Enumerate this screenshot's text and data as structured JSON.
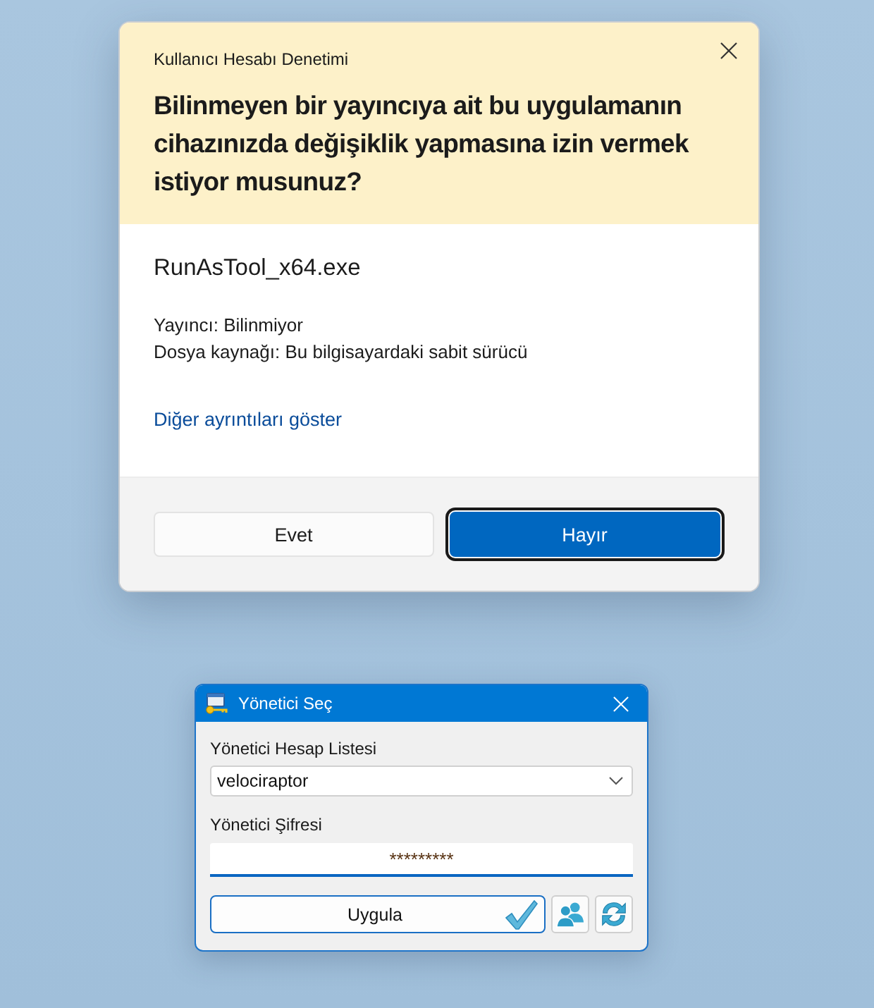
{
  "uac_dialog": {
    "caption": "Kullanıcı Hesabı Denetimi",
    "question": "Bilinmeyen bir yayıncıya ait bu uygulamanın cihazınızda değişiklik yapmasına izin vermek istiyor musunuz?",
    "program_name": "RunAsTool_x64.exe",
    "details": [
      "Yayıncı: Bilinmiyor",
      "Dosya kaynağı: Bu bilgisayardaki sabit sürücü"
    ],
    "more_link": "Diğer ayrıntıları göster",
    "buttons": [
      {
        "label": "Evet",
        "kind": "secondary",
        "focused": false
      },
      {
        "label": "Hayır",
        "kind": "primary",
        "focused": true
      }
    ]
  },
  "admin_dialog": {
    "title": "Yönetici Seç",
    "account_label": "Yönetici Hesap Listesi",
    "account_value": "velociraptor",
    "password_label": "Yönetici Şifresi",
    "password_value": "*********",
    "apply_button": "Uygula"
  }
}
